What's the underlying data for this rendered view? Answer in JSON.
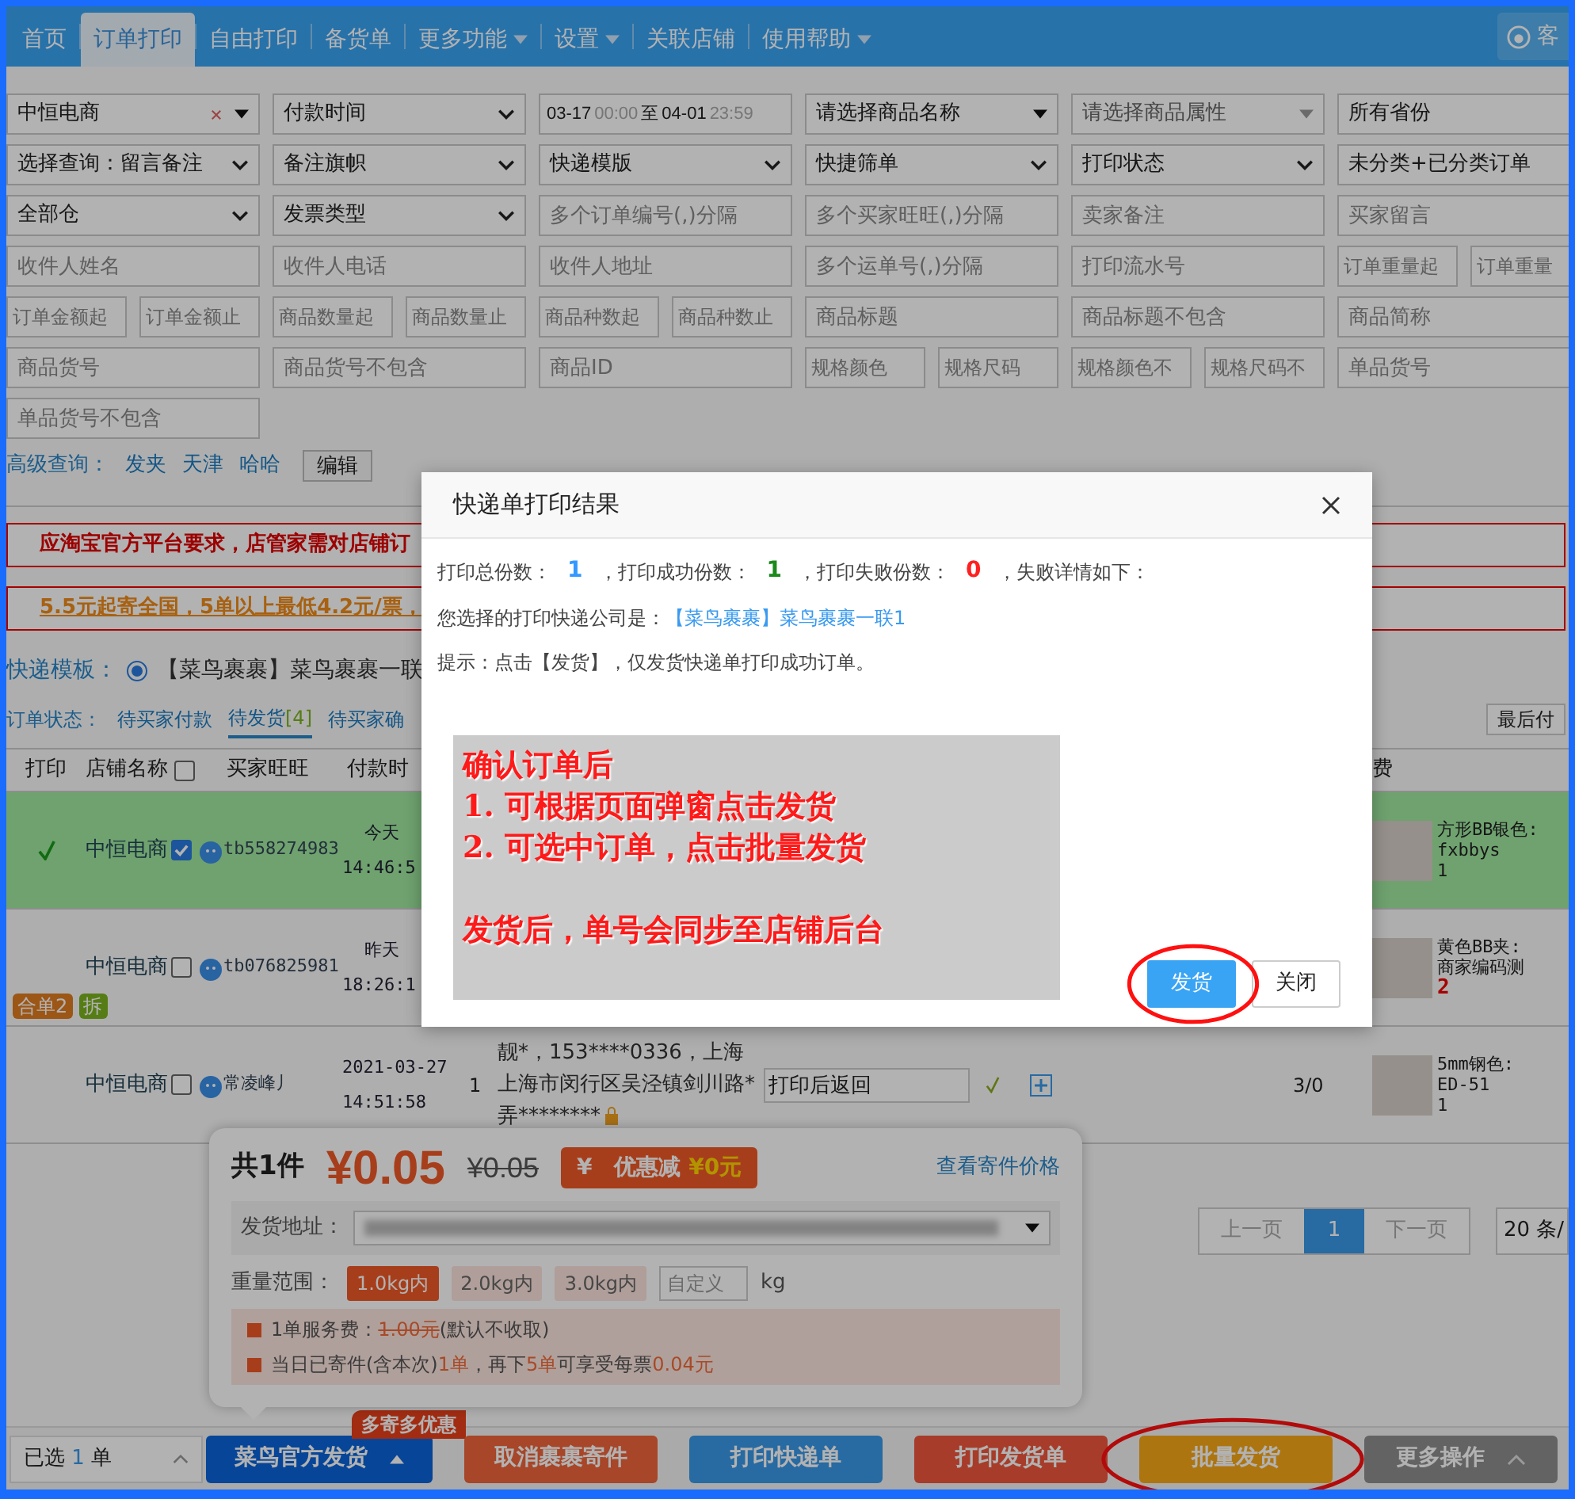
{
  "nav": {
    "tabs": [
      {
        "label": "首页",
        "selected": false,
        "dropdown": false
      },
      {
        "label": "订单打印",
        "selected": true,
        "dropdown": false
      },
      {
        "label": "自由打印",
        "selected": false,
        "dropdown": false
      },
      {
        "label": "备货单",
        "selected": false,
        "dropdown": false
      },
      {
        "label": "更多功能",
        "selected": false,
        "dropdown": true
      },
      {
        "label": "设置",
        "selected": false,
        "dropdown": true
      },
      {
        "label": "关联店铺",
        "selected": false,
        "dropdown": false
      },
      {
        "label": "使用帮助",
        "selected": false,
        "dropdown": true
      }
    ],
    "service": "客"
  },
  "filters": [
    [
      {
        "kind": "shop",
        "value": "中恒电商"
      },
      {
        "kind": "select",
        "value": "付款时间"
      },
      {
        "kind": "date",
        "from_date": "03-17",
        "from_time": "00:00",
        "separator": "至",
        "to_date": "04-01",
        "to_time": "23:59"
      },
      {
        "kind": "dropdown",
        "value": "请选择商品名称",
        "muted": false
      },
      {
        "kind": "dropdown",
        "value": "请选择商品属性",
        "muted": true
      },
      {
        "kind": "text",
        "value": "所有省份"
      }
    ],
    [
      {
        "kind": "select",
        "value": "选择查询：留言备注"
      },
      {
        "kind": "select",
        "value": "备注旗帜"
      },
      {
        "kind": "select",
        "value": "快递模版"
      },
      {
        "kind": "select",
        "value": "快捷筛单"
      },
      {
        "kind": "select",
        "value": "打印状态"
      },
      {
        "kind": "text",
        "value": "未分类+已分类订单"
      }
    ],
    [
      {
        "kind": "select",
        "value": "全部仓"
      },
      {
        "kind": "select",
        "value": "发票类型"
      },
      {
        "kind": "input",
        "placeholder": "多个订单编号(,)分隔"
      },
      {
        "kind": "input",
        "placeholder": "多个买家旺旺(,)分隔"
      },
      {
        "kind": "input",
        "placeholder": "卖家备注"
      },
      {
        "kind": "input",
        "placeholder": "买家留言"
      }
    ],
    [
      {
        "kind": "input",
        "placeholder": "收件人姓名"
      },
      {
        "kind": "input",
        "placeholder": "收件人电话"
      },
      {
        "kind": "input",
        "placeholder": "收件人地址"
      },
      {
        "kind": "input",
        "placeholder": "多个运单号(,)分隔"
      },
      {
        "kind": "input",
        "placeholder": "打印流水号"
      },
      {
        "kind": "pair",
        "placeholders": [
          "订单重量起",
          "订单重量"
        ]
      }
    ],
    [
      {
        "kind": "pair",
        "placeholders": [
          "订单金额起",
          "订单金额止"
        ]
      },
      {
        "kind": "pair",
        "placeholders": [
          "商品数量起",
          "商品数量止"
        ]
      },
      {
        "kind": "pair",
        "placeholders": [
          "商品种数起",
          "商品种数止"
        ]
      },
      {
        "kind": "input",
        "placeholder": "商品标题"
      },
      {
        "kind": "input",
        "placeholder": "商品标题不包含"
      },
      {
        "kind": "input",
        "placeholder": "商品简称"
      }
    ],
    [
      {
        "kind": "input",
        "placeholder": "商品货号"
      },
      {
        "kind": "input",
        "placeholder": "商品货号不包含"
      },
      {
        "kind": "input",
        "placeholder": "商品ID"
      },
      {
        "kind": "pair",
        "placeholders": [
          "规格颜色",
          "规格尺码"
        ]
      },
      {
        "kind": "pair",
        "placeholders": [
          "规格颜色不",
          "规格尺码不"
        ]
      },
      {
        "kind": "input",
        "placeholder": "单品货号"
      }
    ],
    [
      {
        "kind": "input",
        "placeholder": "单品货号不包含"
      }
    ]
  ],
  "advanced": {
    "label": "高级查询：",
    "links": [
      "发夹",
      "天津",
      "哈哈"
    ],
    "edit": "编辑"
  },
  "notices": [
    {
      "kind": "notice",
      "text": "应淘宝官方平台要求，店管家需对店铺订"
    },
    {
      "kind": "promo",
      "text": "5.5元起寄全国，5单以上最低4.2元/票，"
    }
  ],
  "template": {
    "label": "快递模板：",
    "option": "【菜鸟裹裹】菜鸟裹裹一联",
    "selected": true
  },
  "status": {
    "label": "订单状态：",
    "tabs": [
      {
        "label": "待买家付款",
        "selected": false
      },
      {
        "label": "待发货",
        "count": "[4]",
        "selected": true
      },
      {
        "label": "待买家确",
        "selected": false
      }
    ],
    "sort": "最后付"
  },
  "table": {
    "columns": [
      "打印",
      "店铺名称",
      "买家旺旺",
      "付款时",
      "费"
    ],
    "header_checked": false,
    "rows": [
      {
        "printed": true,
        "highlighted": true,
        "shop": "中恒电商",
        "checked": true,
        "buyer": "tb558274983",
        "pay_day": "今天",
        "pay_time": "14:46:5",
        "product": {
          "title": "方形BB银色:",
          "code": "fxbbys",
          "qty": "1",
          "alert": false
        }
      },
      {
        "printed": false,
        "highlighted": false,
        "shop": "中恒电商",
        "checked": false,
        "buyer": "tb076825981",
        "pay_day": "昨天",
        "pay_time": "18:26:1",
        "tags": [
          {
            "label": "合单2",
            "kind": "merged"
          },
          {
            "label": "拆",
            "kind": "split"
          }
        ],
        "product": {
          "title": "黄色BB夹:",
          "code": "商家编码测",
          "qty": "2",
          "alert": true
        }
      },
      {
        "printed": false,
        "highlighted": false,
        "shop": "中恒电商",
        "checked": false,
        "buyer": "常凌峰丿",
        "pay_day": "2021-03-27",
        "pay_time": "14:51:58",
        "quantity": "1",
        "address": "靓*，153****0336，上海上海市闵行区吴泾镇剑川路*弄********",
        "remark": "打印后返回",
        "verified": true,
        "ratio": "3/0",
        "product": {
          "title": "5mm钢色:",
          "code": "ED-51",
          "qty": "1",
          "alert": false
        }
      }
    ]
  },
  "pagination": {
    "prev": "上一页",
    "pages": [
      {
        "label": "1",
        "selected": true
      }
    ],
    "next": "下一页",
    "per_page": "20 条/"
  },
  "shipping_popup": {
    "count": "共1件",
    "price": "¥0.05",
    "original_price": "¥0.05",
    "coupon": {
      "symbol": "¥",
      "label": "优惠减",
      "amount": "¥0元"
    },
    "price_link": "查看寄件价格",
    "address_label": "发货地址：",
    "weight_label": "重量范围：",
    "weights": [
      {
        "label": "1.0kg内",
        "selected": true
      },
      {
        "label": "2.0kg内",
        "selected": false
      },
      {
        "label": "3.0kg内",
        "selected": false
      }
    ],
    "custom_placeholder": "自定义",
    "unit": "kg",
    "notes": [
      [
        {
          "text": "1单服务费：",
          "kind": "plain"
        },
        {
          "text": "1.00元",
          "kind": "struck"
        },
        {
          "text": "(默认不收取)",
          "kind": "plain"
        }
      ],
      [
        {
          "text": "当日已寄件(含本次)",
          "kind": "plain"
        },
        {
          "text": "1单",
          "kind": "accent"
        },
        {
          "text": "，再下",
          "kind": "plain"
        },
        {
          "text": "5单",
          "kind": "accent"
        },
        {
          "text": "可享受每票",
          "kind": "plain"
        },
        {
          "text": "0.04元",
          "kind": "accent"
        }
      ]
    ]
  },
  "bottom_bar": {
    "selection": {
      "prefix": "已选",
      "count": "1",
      "suffix": "单"
    },
    "buttons": [
      {
        "label": "菜鸟官方发货",
        "kind": "cainiao",
        "badge": "多寄多优惠",
        "circled": false
      },
      {
        "label": "取消裹裹寄件",
        "kind": "cancel",
        "circled": false
      },
      {
        "label": "打印快递单",
        "kind": "express",
        "circled": false
      },
      {
        "label": "打印发货单",
        "kind": "invoice",
        "circled": false
      },
      {
        "label": "批量发货",
        "kind": "batch",
        "circled": true
      },
      {
        "label": "更多操作",
        "kind": "more",
        "circled": false
      }
    ]
  },
  "modal": {
    "title": "快递单打印结果",
    "stats": [
      {
        "label": "打印总份数：",
        "value": "1",
        "color": "#3399ff"
      },
      {
        "label": "，打印成功份数：",
        "value": "1",
        "color": "#1a8a1a"
      },
      {
        "label": "，打印失败份数：",
        "value": "0",
        "color": "#ff2020"
      }
    ],
    "stats_tail": "，失败详情如下：",
    "company_label": "您选择的打印快递公司是：",
    "company": "【菜鸟裹裹】菜鸟裹裹一联1",
    "tip": "提示：点击【发货】，仅发货快递单打印成功订单。",
    "annotation": {
      "lines": [
        "确认订单后",
        "1. 可根据页面弹窗点击发货",
        "2. 可选中订单，点击批量发货"
      ],
      "footer": "发货后，单号会同步至店铺后台"
    },
    "confirm": {
      "label": "发货",
      "circled": true
    },
    "close": "关闭"
  }
}
